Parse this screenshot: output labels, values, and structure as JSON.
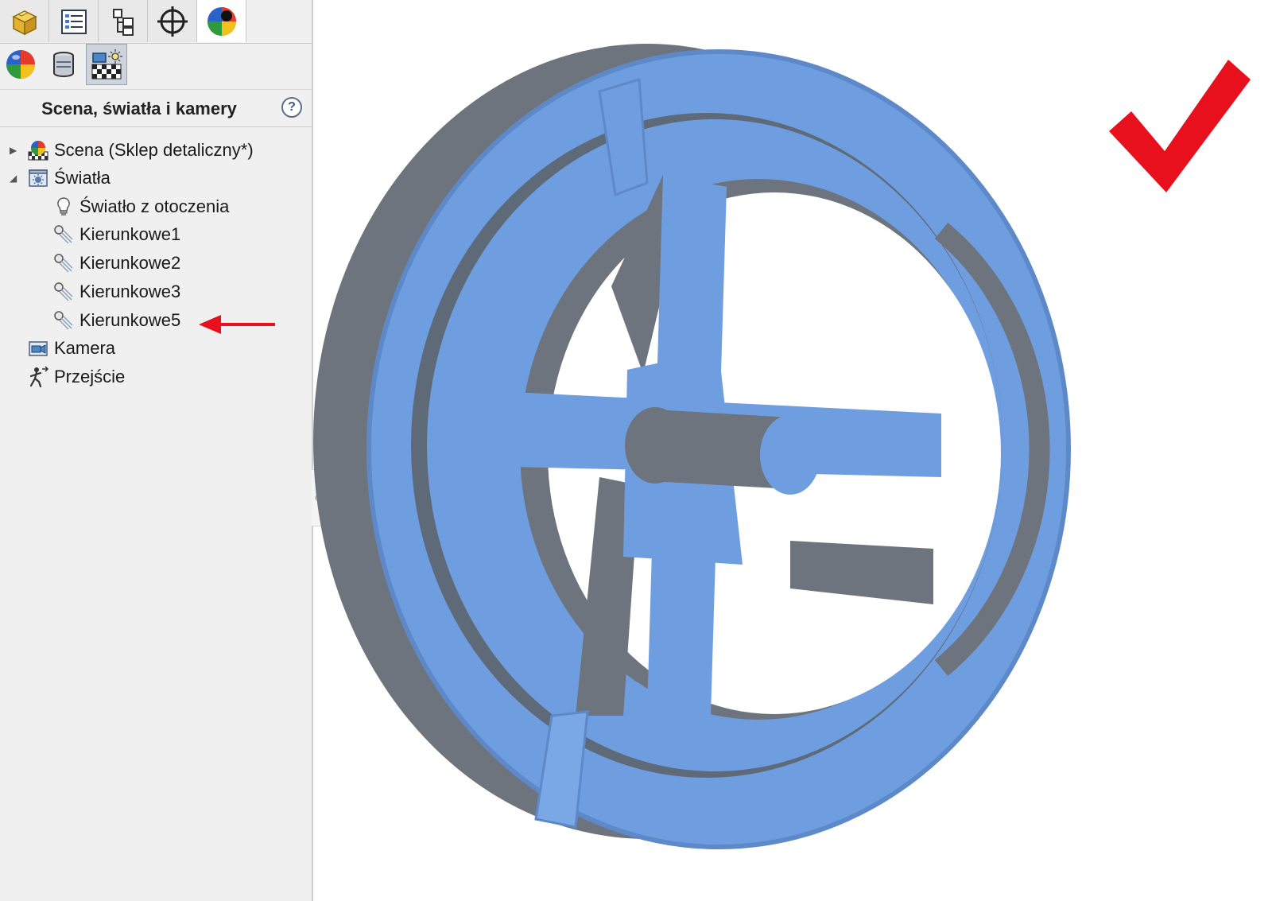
{
  "panel": {
    "title": "Scena, światła i kamery",
    "help_label": "?"
  },
  "tabs_row1": [
    {
      "icon": "part-icon",
      "active": false
    },
    {
      "icon": "feature-tree-icon",
      "active": false
    },
    {
      "icon": "config-manager-icon",
      "active": false
    },
    {
      "icon": "dimxpert-icon",
      "active": false
    },
    {
      "icon": "display-manager-icon",
      "active": true
    }
  ],
  "tabs_row2": [
    {
      "icon": "appearances-icon",
      "active": false
    },
    {
      "icon": "decals-icon",
      "active": false
    },
    {
      "icon": "scene-lights-cameras-icon",
      "active": true
    }
  ],
  "tree": {
    "scene": "Scena (Sklep detaliczny*)",
    "lights": "Światła",
    "ambient": "Światło z otoczenia",
    "dir1": "Kierunkowe1",
    "dir2": "Kierunkowe2",
    "dir3": "Kierunkowe3",
    "dir5": "Kierunkowe5",
    "camera": "Kamera",
    "walkthrough": "Przejście"
  },
  "colors": {
    "model_blue": "#6f9ee0",
    "model_shadow": "#6d747e",
    "annotation_red": "#e8101c"
  }
}
